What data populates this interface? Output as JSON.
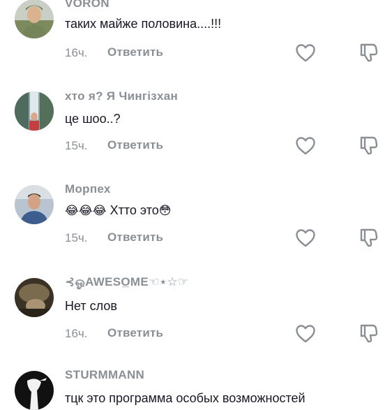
{
  "comments": [
    {
      "username": "VORON",
      "text": "таких майже половина....!!!",
      "time": "16ч.",
      "reply_label": "Ответить",
      "avatar": "soldier-avatar"
    },
    {
      "username": "хто я? Я Чингізхан",
      "text": "це шоо..?",
      "time": "15ч.",
      "reply_label": "Ответить",
      "avatar": "waterfall-avatar"
    },
    {
      "username": "Морпех",
      "emojis": "😂😂😂",
      "text": " Хтто это",
      "emoji_end": "😳",
      "time": "15ч.",
      "reply_label": "Ответить",
      "avatar": "man-avatar"
    },
    {
      "username": "⊰ஓAWESO̲ME☜⋆☆☞",
      "text": "Нет слов",
      "time": "16ч.",
      "reply_label": "Ответить",
      "avatar": "dark-photo-avatar"
    },
    {
      "username": "STURMMANN",
      "text": "тцк это программа особых возможностей",
      "avatar": "silhouette-avatar"
    }
  ],
  "icons": {
    "like": "heart-outline-icon",
    "dislike": "thumbs-down-outline-icon"
  },
  "colors": {
    "secondary_text": "#8a8f95",
    "primary_text": "#161823",
    "icon": "#8a8f95"
  }
}
